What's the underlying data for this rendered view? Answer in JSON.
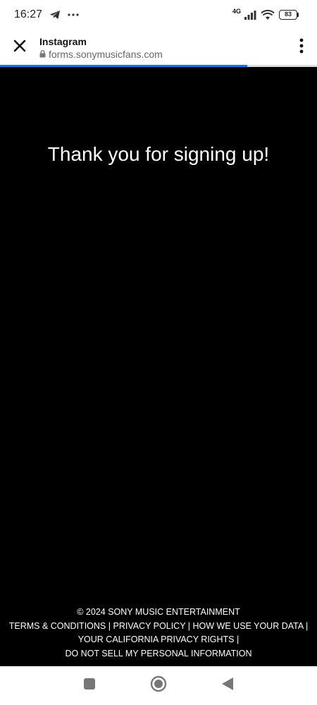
{
  "status_bar": {
    "time": "16:27",
    "network": "4G",
    "battery": "83",
    "icons": [
      "telegram-icon",
      "more-dots-icon",
      "signal-icon",
      "wifi-icon",
      "battery-icon"
    ]
  },
  "browser": {
    "title": "Instagram",
    "url": "forms.sonymusicfans.com",
    "load_progress": 0.78,
    "icons": [
      "close-icon",
      "lock-icon",
      "overflow-menu-icon"
    ]
  },
  "content": {
    "heading": "Thank you for signing up!"
  },
  "footer": {
    "copyright": "© 2024 SONY MUSIC ENTERTAINMENT",
    "links": {
      "terms": "TERMS & CONDITIONS",
      "privacy": "PRIVACY POLICY",
      "data": "HOW WE USE YOUR DATA",
      "california": "YOUR CALIFORNIA PRIVACY RIGHTS",
      "do_not_sell": "DO NOT SELL MY PERSONAL INFORMATION"
    },
    "separator": "|"
  },
  "nav_bar": {
    "icons": [
      "recents-square-icon",
      "home-circle-icon",
      "back-triangle-icon"
    ]
  },
  "colors": {
    "accent": "#1a73e8",
    "background": "#000000",
    "text": "#ffffff"
  }
}
